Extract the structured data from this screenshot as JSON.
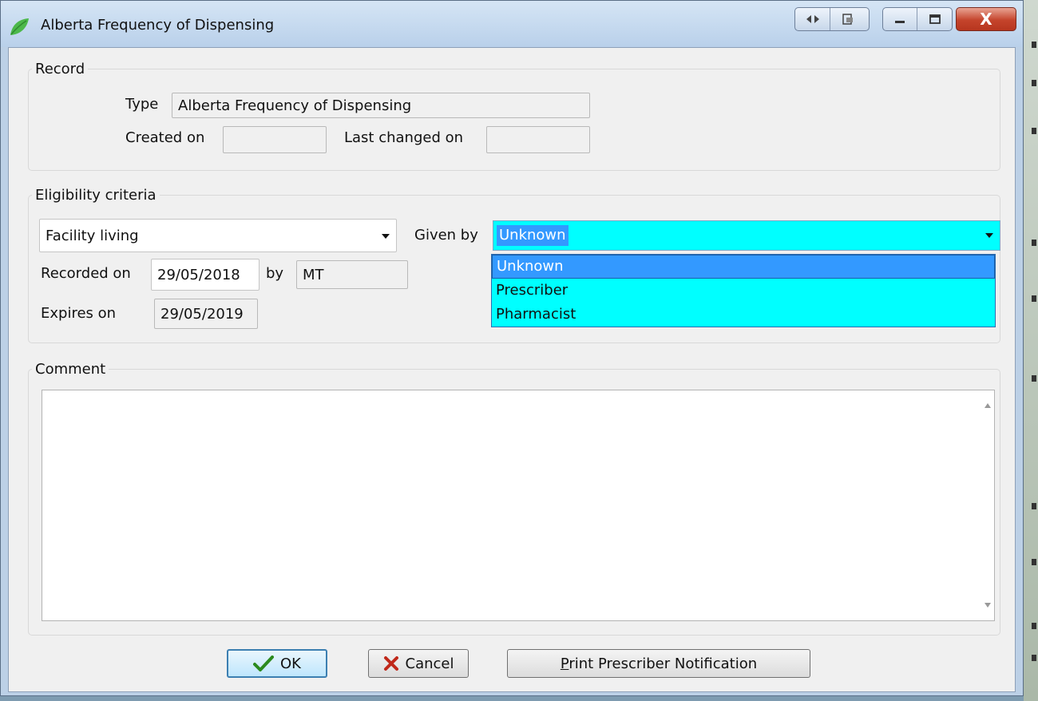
{
  "window": {
    "title": "Alberta Frequency of Dispensing"
  },
  "titlebar_buttons": {
    "resize_icon": "resize-horizontal-icon",
    "restore_icon": "restore-window-icon",
    "minimize_icon": "minimize-icon",
    "maximize_icon": "maximize-icon",
    "close_label": "X"
  },
  "record": {
    "legend": "Record",
    "type_label": "Type",
    "type_value": "Alberta Frequency of Dispensing",
    "created_on_label": "Created on",
    "created_on_value": "",
    "last_changed_label": "Last changed on",
    "last_changed_value": ""
  },
  "eligibility": {
    "legend": "Eligibility criteria",
    "criteria_value": "Facility living",
    "given_by_label": "Given by",
    "given_by_value": "Unknown",
    "given_by_options": [
      "Unknown",
      "Prescriber",
      "Pharmacist"
    ],
    "recorded_on_label": "Recorded on",
    "recorded_on_value": "29/05/2018",
    "by_label": "by",
    "by_value": "MT",
    "expires_on_label": "Expires on",
    "expires_on_value": "29/05/2019"
  },
  "comment": {
    "legend": "Comment",
    "value": ""
  },
  "buttons": {
    "ok": "OK",
    "cancel": "Cancel",
    "print_prefix": "P",
    "print_rest": "rint Prescriber Notification"
  },
  "colors": {
    "highlight": "#3399ff",
    "combo_bg": "#00ffff"
  }
}
